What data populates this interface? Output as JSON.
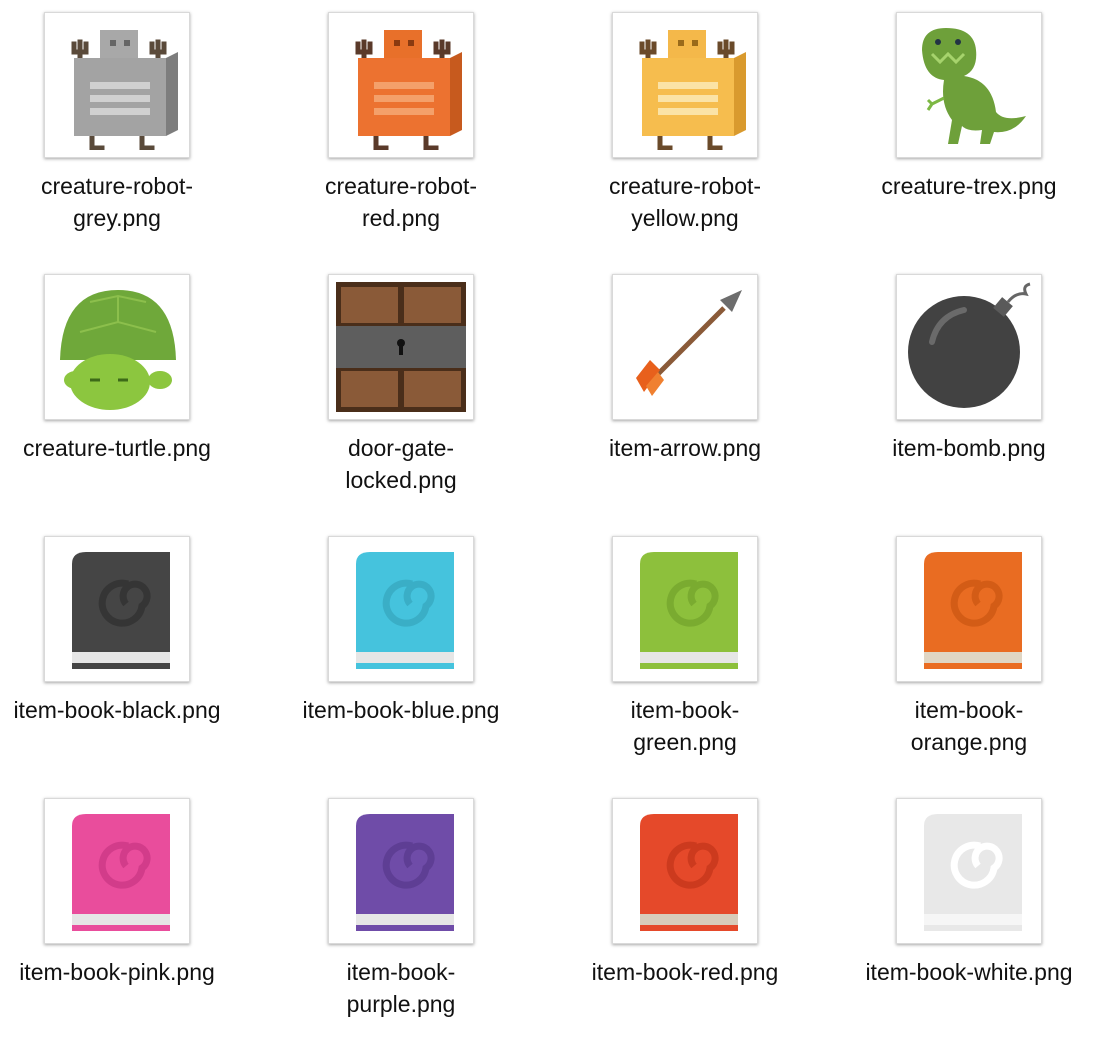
{
  "files": [
    {
      "name": "creature-robot-grey.png",
      "lines": [
        "creature-robot-",
        "grey.png"
      ],
      "icon": "robot-grey-icon",
      "color": "#9b9b9b"
    },
    {
      "name": "creature-robot-red.png",
      "lines": [
        "creature-robot-",
        "red.png"
      ],
      "icon": "robot-red-icon",
      "color": "#e8702a"
    },
    {
      "name": "creature-robot-yellow.png",
      "lines": [
        "creature-robot-",
        "yellow.png"
      ],
      "icon": "robot-yellow-icon",
      "color": "#f5b94a"
    },
    {
      "name": "creature-trex.png",
      "lines": [
        "creature-trex.png"
      ],
      "icon": "trex-icon",
      "color": "#6ea03a"
    },
    {
      "name": "creature-turtle.png",
      "lines": [
        "creature-turtle.png"
      ],
      "icon": "turtle-icon",
      "color": "#6fa83a"
    },
    {
      "name": "door-gate-locked.png",
      "lines": [
        "door-gate-",
        "locked.png"
      ],
      "icon": "locked-door-icon",
      "color": "#8a5a38"
    },
    {
      "name": "item-arrow.png",
      "lines": [
        "item-arrow.png"
      ],
      "icon": "arrow-icon",
      "color": "#e8601c"
    },
    {
      "name": "item-bomb.png",
      "lines": [
        "item-bomb.png"
      ],
      "icon": "bomb-icon",
      "color": "#444444"
    },
    {
      "name": "item-book-black.png",
      "lines": [
        "item-book-black.png"
      ],
      "icon": "book-black-icon",
      "color": "#454545"
    },
    {
      "name": "item-book-blue.png",
      "lines": [
        "item-book-blue.png"
      ],
      "icon": "book-blue-icon",
      "color": "#45c3dd"
    },
    {
      "name": "item-book-green.png",
      "lines": [
        "item-book-",
        "green.png"
      ],
      "icon": "book-green-icon",
      "color": "#8dc03c"
    },
    {
      "name": "item-book-orange.png",
      "lines": [
        "item-book-",
        "orange.png"
      ],
      "icon": "book-orange-icon",
      "color": "#e96c22"
    },
    {
      "name": "item-book-pink.png",
      "lines": [
        "item-book-pink.png"
      ],
      "icon": "book-pink-icon",
      "color": "#e94d9c"
    },
    {
      "name": "item-book-purple.png",
      "lines": [
        "item-book-",
        "purple.png"
      ],
      "icon": "book-purple-icon",
      "color": "#6f4ca8"
    },
    {
      "name": "item-book-red.png",
      "lines": [
        "item-book-red.png"
      ],
      "icon": "book-red-icon",
      "color": "#e5492a"
    },
    {
      "name": "item-book-white.png",
      "lines": [
        "item-book-white.png"
      ],
      "icon": "book-white-icon",
      "color": "#e8e8e8"
    }
  ]
}
